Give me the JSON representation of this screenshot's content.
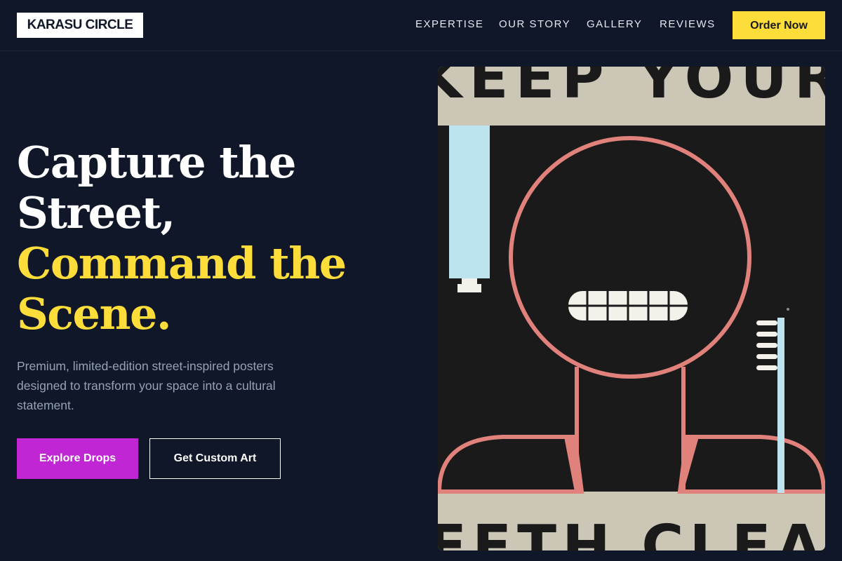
{
  "brand": {
    "logo_text": "KARASU CIRCLE"
  },
  "nav": {
    "links": [
      "EXPERTISE",
      "OUR STORY",
      "GALLERY",
      "REVIEWS"
    ],
    "cta_label": "Order Now"
  },
  "hero": {
    "headline_line1": "Capture the",
    "headline_line2": "Street,",
    "headline_line3": "Command the",
    "headline_line4": "Scene.",
    "description": "Premium, limited-edition street-inspired posters designed to transform your space into a cultural statement.",
    "primary_button": "Explore Drops",
    "secondary_button": "Get Custom Art"
  },
  "poster": {
    "top_text": "KEEP YOUR",
    "bottom_text": "TEETH CLEAN"
  },
  "colors": {
    "background": "#101729",
    "accent_yellow": "#fcdd3a",
    "accent_magenta": "#c026d3",
    "muted_text": "#95a1b7",
    "poster_salmon": "#e0827b",
    "poster_beige": "#cbc6b5",
    "poster_blue": "#bde3ee"
  }
}
